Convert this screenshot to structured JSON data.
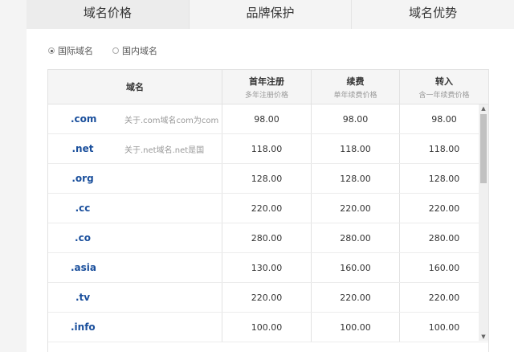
{
  "tabs": [
    {
      "label": "域名价格",
      "active": true
    },
    {
      "label": "品牌保护",
      "active": false
    },
    {
      "label": "域名优势",
      "active": false
    }
  ],
  "filter": {
    "options": [
      {
        "label": "国际域名",
        "checked": true
      },
      {
        "label": "国内域名",
        "checked": false
      }
    ]
  },
  "table": {
    "headers": [
      {
        "main": "域名",
        "sub": ""
      },
      {
        "main": "首年注册",
        "sub": "多年注册价格"
      },
      {
        "main": "续费",
        "sub": "单年续费价格"
      },
      {
        "main": "转入",
        "sub": "含一年续费价格"
      }
    ],
    "rows": [
      {
        "ext": ".com",
        "desc": "关于.com域名com为com",
        "register": "98.00",
        "renew": "98.00",
        "transfer": "98.00"
      },
      {
        "ext": ".net",
        "desc": "关于.net域名.net是国",
        "register": "118.00",
        "renew": "118.00",
        "transfer": "118.00"
      },
      {
        "ext": ".org",
        "desc": "",
        "register": "128.00",
        "renew": "128.00",
        "transfer": "128.00"
      },
      {
        "ext": ".cc",
        "desc": "",
        "register": "220.00",
        "renew": "220.00",
        "transfer": "220.00"
      },
      {
        "ext": ".co",
        "desc": "",
        "register": "280.00",
        "renew": "280.00",
        "transfer": "280.00"
      },
      {
        "ext": ".asia",
        "desc": "",
        "register": "130.00",
        "renew": "160.00",
        "transfer": "160.00"
      },
      {
        "ext": ".tv",
        "desc": "",
        "register": "220.00",
        "renew": "220.00",
        "transfer": "220.00"
      },
      {
        "ext": ".info",
        "desc": "",
        "register": "100.00",
        "renew": "100.00",
        "transfer": "100.00"
      }
    ]
  },
  "scrollbar": {
    "up_icon": "arrow-up-icon",
    "down_icon": "arrow-down-icon"
  }
}
